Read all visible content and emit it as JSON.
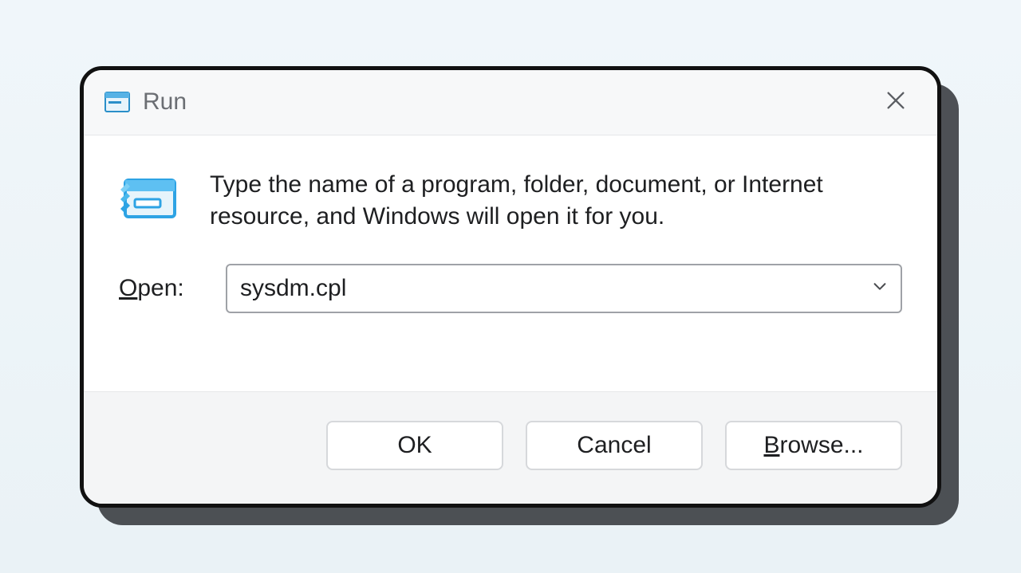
{
  "titlebar": {
    "title": "Run"
  },
  "body": {
    "description": "Type the name of a program, folder, document, or Internet resource, and Windows will open it for you.",
    "open_label_underline": "O",
    "open_label_rest": "pen:",
    "open_value": "sysdm.cpl"
  },
  "footer": {
    "ok_label": "OK",
    "cancel_label": "Cancel",
    "browse_underline": "B",
    "browse_rest": "rowse..."
  }
}
